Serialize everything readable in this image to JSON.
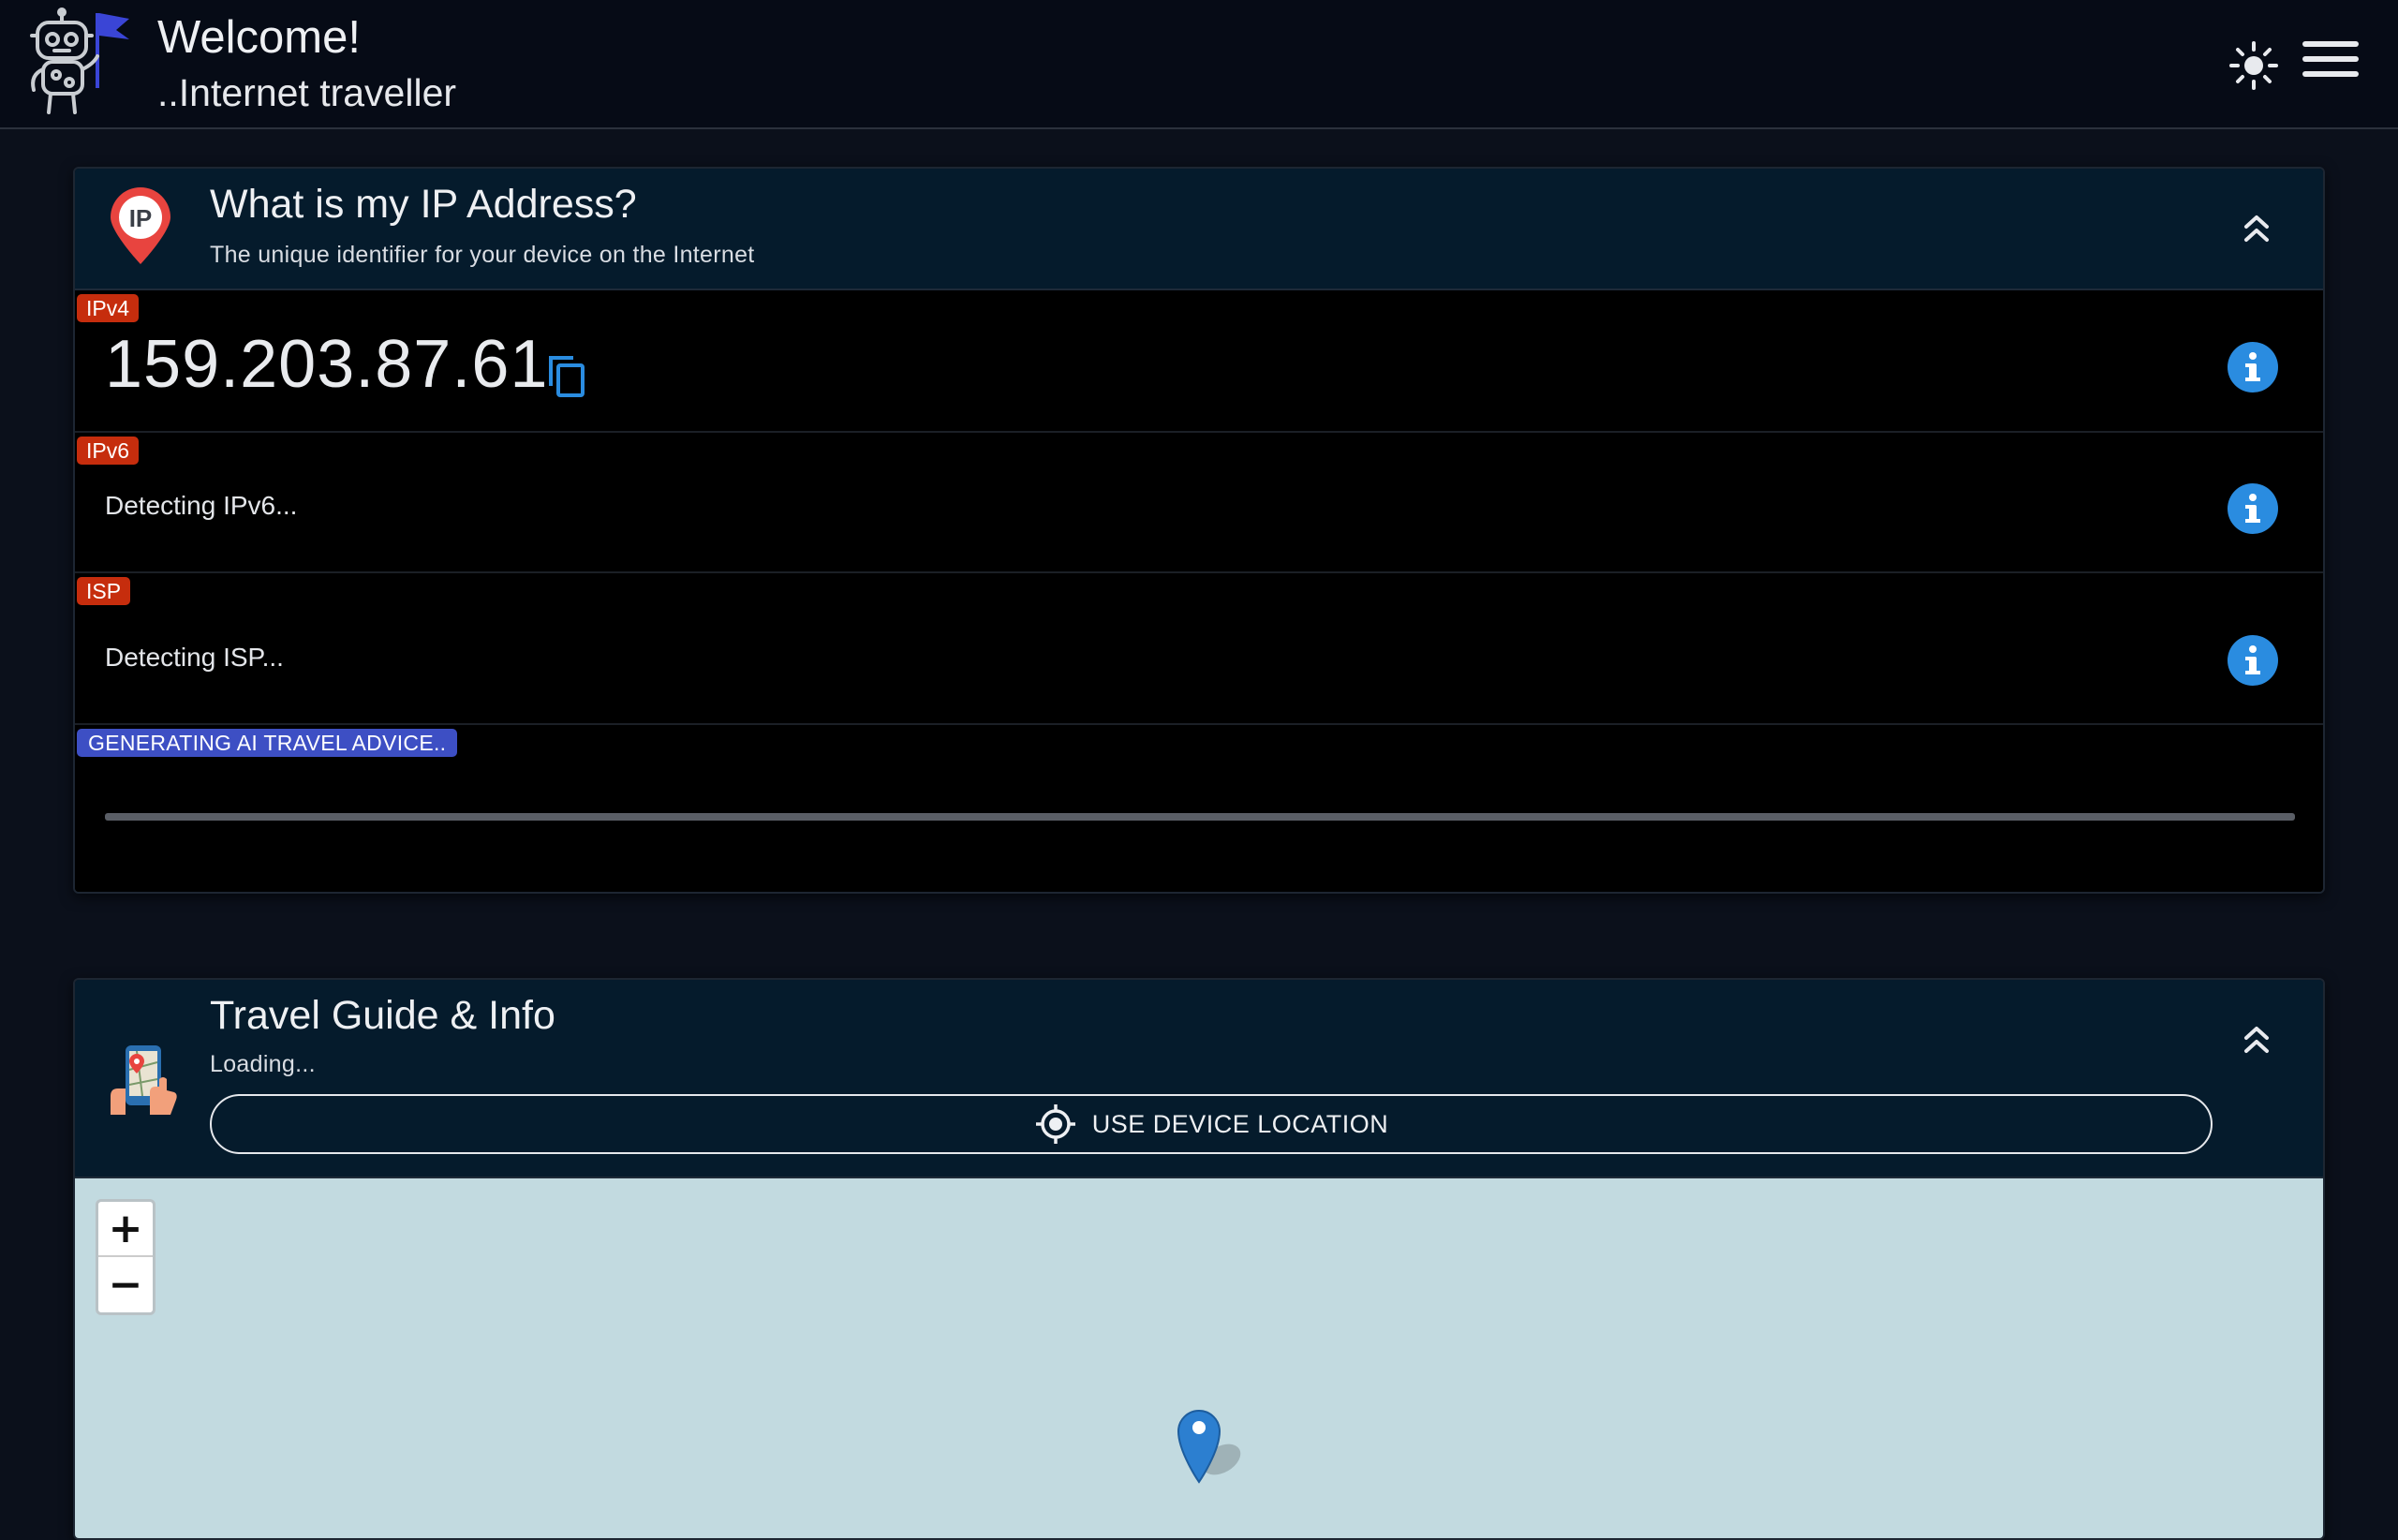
{
  "header": {
    "welcome": "Welcome!",
    "subtitle": "..Internet traveller",
    "logo_icon": "robot-flag-icon",
    "theme_icon": "sun-icon",
    "menu_icon": "hamburger-menu-icon"
  },
  "ip_card": {
    "title": "What is my IP Address?",
    "description": "The unique identifier for your device on the Internet",
    "icon": "ip-location-pin-icon",
    "collapse_icon": "double-chevron-up-icon",
    "rows": {
      "ipv4": {
        "badge": "IPv4",
        "value": "159.203.87.61",
        "copy_icon": "copy-icon",
        "info_icon": "info-icon"
      },
      "ipv6": {
        "badge": "IPv6",
        "value": "Detecting IPv6...",
        "info_icon": "info-icon"
      },
      "isp": {
        "badge": "ISP",
        "value": "Detecting ISP...",
        "info_icon": "info-icon"
      }
    },
    "ai_advice": {
      "badge": "GENERATING AI TRAVEL ADVICE..",
      "progress": 1.0
    }
  },
  "travel_card": {
    "title": "Travel Guide & Info",
    "status": "Loading...",
    "icon": "travel-map-phone-icon",
    "collapse_icon": "double-chevron-up-icon",
    "location_button": "USE DEVICE LOCATION",
    "location_icon": "crosshair-icon"
  },
  "map": {
    "zoom_in": "+",
    "zoom_out": "−",
    "marker_icon": "map-marker-icon"
  },
  "colors": {
    "background": "#0b101b",
    "card_header": "#051b2c",
    "badge_red": "#c62d0d",
    "badge_blue": "#3d4fc4",
    "info_blue": "#2a8ce0",
    "map_water": "#c2dae0"
  }
}
